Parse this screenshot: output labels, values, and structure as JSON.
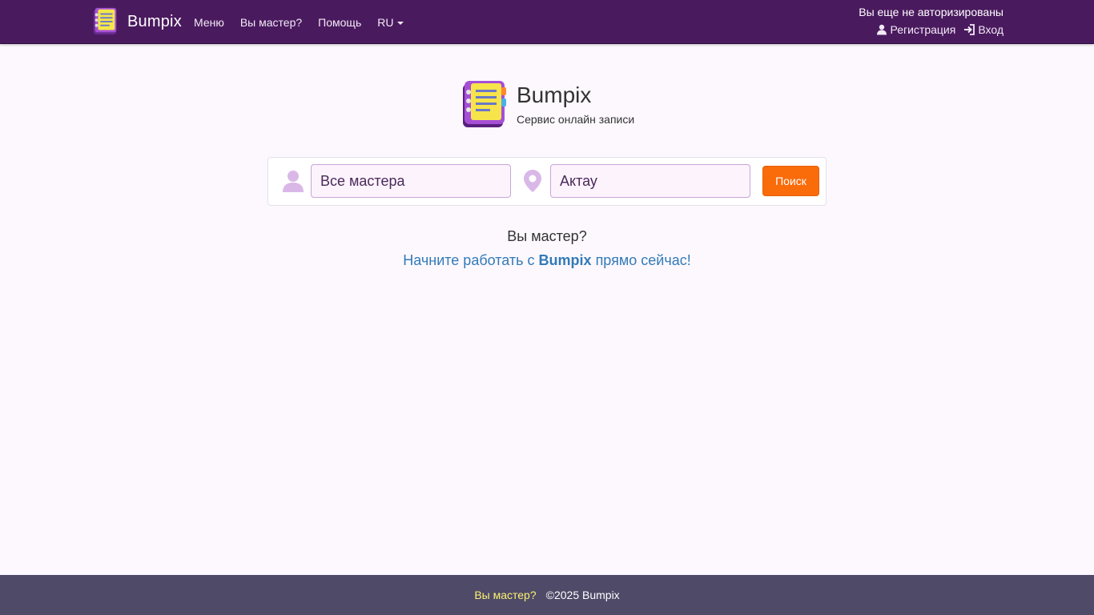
{
  "navbar": {
    "brand": "Bumpix",
    "links": [
      {
        "label": "Меню"
      },
      {
        "label": "Вы мастер?"
      },
      {
        "label": "Помощь"
      }
    ],
    "language": "RU",
    "auth": {
      "status": "Вы еще не авторизированы",
      "register_label": "Регистрация",
      "login_label": "Вход"
    }
  },
  "hero": {
    "title": "Bumpix",
    "subtitle": "Сервис онлайн записи"
  },
  "search": {
    "master_value": "Все мастера",
    "city_value": "Актау",
    "button_label": "Поиск"
  },
  "cta": {
    "question": "Вы мастер?",
    "link_prefix": "Начните работать с ",
    "link_brand": "Bumpix",
    "link_suffix": " прямо сейчас!"
  },
  "footer": {
    "link_label": "Вы мастер?",
    "copyright": "©2025 Bumpix"
  },
  "colors": {
    "navbar_bg": "#4a1a5e",
    "accent_orange": "#fa6b0a",
    "link_blue": "#337ab7",
    "footer_bg": "#4e4a68",
    "footer_link": "#fdf070",
    "page_bg": "#fcf8fe"
  },
  "icons": {
    "brand": "notebook-logo-icon",
    "register": "user-icon",
    "login": "sign-in-icon",
    "master_field": "person-icon",
    "city_field": "map-marker-icon"
  }
}
